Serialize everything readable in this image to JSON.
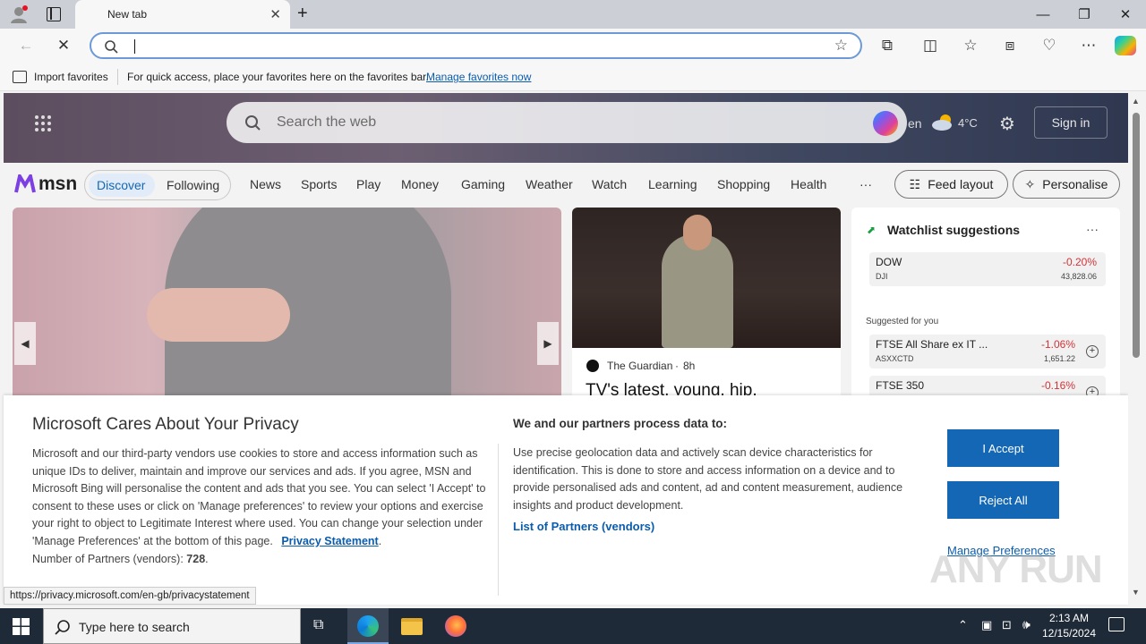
{
  "browser": {
    "tab_title": "New tab",
    "address_value": "",
    "favbar_import": "Import favorites",
    "favbar_message": "For quick access, place your favorites here on the favorites bar.",
    "favbar_link": "Manage favorites now"
  },
  "msn": {
    "search_placeholder": "Search the web",
    "lang": "en",
    "temperature": "4°C",
    "sign_in": "Sign in",
    "logo": "msn",
    "tabs": [
      "Discover",
      "Following"
    ],
    "nav": [
      "News",
      "Sports",
      "Play",
      "Money",
      "Gaming",
      "Weather",
      "Watch",
      "Learning",
      "Shopping",
      "Health"
    ],
    "more": "···",
    "feed_layout": "Feed layout",
    "personalise": "Personalise",
    "article": {
      "source": "The Guardian",
      "age": "8h",
      "headline": "TV's latest, young, hip,"
    },
    "watchlist": {
      "title": "Watchlist suggestions",
      "more": "···",
      "top": {
        "name": "DOW",
        "symbol": "DJI",
        "change": "-0.20%",
        "value": "43,828.06"
      },
      "suggested_label": "Suggested for you",
      "suggested": [
        {
          "name": "FTSE All Share ex IT ...",
          "symbol": "ASXXCTD",
          "change": "-1.06%",
          "value": "1,651.22"
        },
        {
          "name": "FTSE 350",
          "symbol": "",
          "change": "-0.16%",
          "value": ""
        }
      ]
    }
  },
  "consent": {
    "title": "Microsoft Cares About Your Privacy",
    "body": "Microsoft and our third-party vendors use cookies to store and access information such as unique IDs to deliver, maintain and improve our services and ads. If you agree, MSN and Microsoft Bing will personalise the content and ads that you see. You can select 'I Accept' to consent to these uses or click on 'Manage preferences' to review your options and exercise your right to object to Legitimate Interest where used.  You can change your selection under 'Manage Preferences' at the bottom of this page.",
    "privacy_link": "Privacy Statement",
    "partners_label": "Number of Partners (vendors):",
    "partners_count": "728",
    "right_title": "We and our partners process data to:",
    "right_body": "Use precise geolocation data and actively scan device characteristics for identification. This is done to store and access information on a device and to provide personalised ads and content, ad and content measurement, audience insights and product development.",
    "partners_link": "List of Partners (vendors)",
    "accept": "I Accept",
    "reject": "Reject All",
    "manage": "Manage Preferences"
  },
  "status_url": "https://privacy.microsoft.com/en-gb/privacystatement",
  "watermark": "ANY RUN",
  "taskbar": {
    "search_placeholder": "Type here to search",
    "time": "2:13 AM",
    "date": "12/15/2024"
  },
  "colors": {
    "accent": "#1467b5",
    "negative": "#d13438",
    "link": "#0b5cad"
  }
}
